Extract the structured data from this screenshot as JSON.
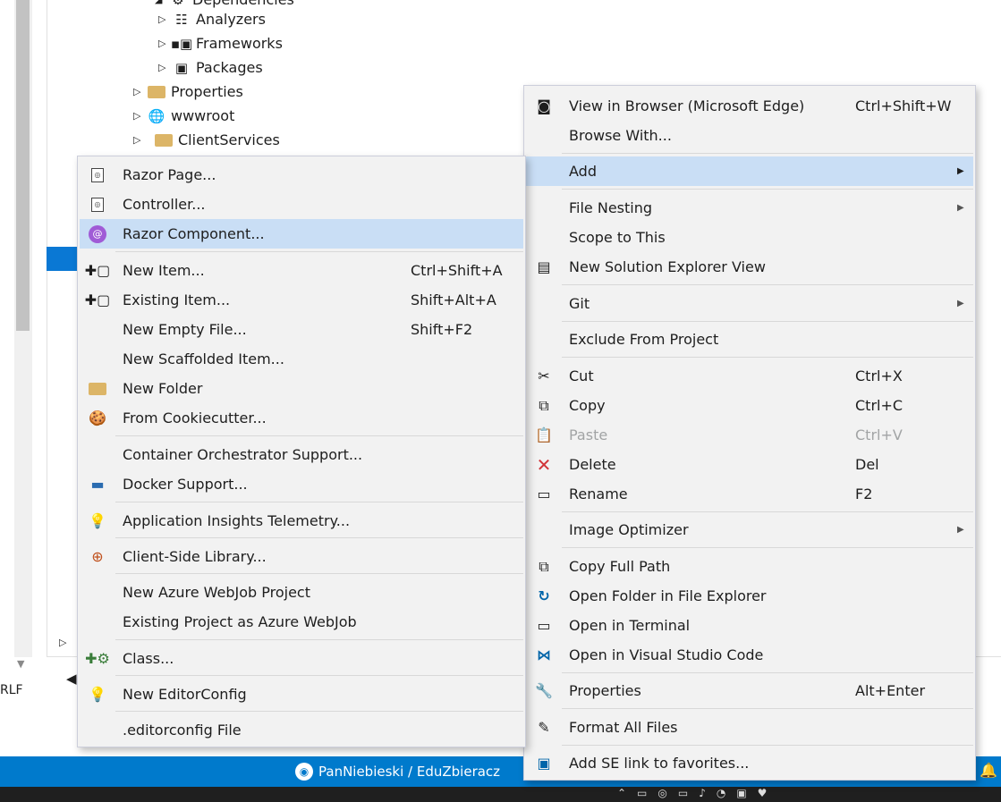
{
  "tree": {
    "nodes": [
      {
        "label": "Dependencies",
        "icon": "dependencies-icon"
      },
      {
        "label": "Analyzers",
        "icon": "analyzers-icon"
      },
      {
        "label": "Frameworks",
        "icon": "frameworks-icon"
      },
      {
        "label": "Packages",
        "icon": "packages-icon"
      },
      {
        "label": "Properties",
        "icon": "properties-folder-icon"
      },
      {
        "label": "wwwroot",
        "icon": "globe-icon"
      },
      {
        "label": "ClientServices",
        "icon": "folder-icon"
      }
    ]
  },
  "status": {
    "repo": "PanNiebieski / EduZbieracz",
    "line_ending": "RLF"
  },
  "add_submenu": {
    "items": [
      {
        "label": "Razor Page...",
        "shortcut": "",
        "icon": "razor-page-icon"
      },
      {
        "label": "Controller...",
        "shortcut": "",
        "icon": "controller-icon"
      },
      {
        "label": "Razor Component...",
        "shortcut": "",
        "icon": "blazor-icon"
      },
      {
        "label": "New Item...",
        "shortcut": "Ctrl+Shift+A",
        "icon": "new-item-icon"
      },
      {
        "label": "Existing Item...",
        "shortcut": "Shift+Alt+A",
        "icon": "existing-item-icon"
      },
      {
        "label": "New Empty File...",
        "shortcut": "Shift+F2",
        "icon": ""
      },
      {
        "label": "New Scaffolded Item...",
        "shortcut": "",
        "icon": ""
      },
      {
        "label": "New Folder",
        "shortcut": "",
        "icon": "new-folder-icon"
      },
      {
        "label": "From Cookiecutter...",
        "shortcut": "",
        "icon": "cookiecutter-icon"
      },
      {
        "label": "Container Orchestrator Support...",
        "shortcut": "",
        "icon": ""
      },
      {
        "label": "Docker Support...",
        "shortcut": "",
        "icon": "docker-icon"
      },
      {
        "label": "Application Insights Telemetry...",
        "shortcut": "",
        "icon": "app-insights-icon"
      },
      {
        "label": "Client-Side Library...",
        "shortcut": "",
        "icon": "client-library-icon"
      },
      {
        "label": "New Azure WebJob Project",
        "shortcut": "",
        "icon": ""
      },
      {
        "label": "Existing Project as Azure WebJob",
        "shortcut": "",
        "icon": ""
      },
      {
        "label": "Class...",
        "shortcut": "",
        "icon": "class-icon"
      },
      {
        "label": "New EditorConfig",
        "shortcut": "",
        "icon": "editorconfig-icon"
      },
      {
        "label": ".editorconfig File",
        "shortcut": "",
        "icon": ""
      }
    ]
  },
  "context_menu": {
    "items": [
      {
        "label": "View in Browser (Microsoft Edge)",
        "shortcut": "Ctrl+Shift+W",
        "icon": "browser-icon"
      },
      {
        "label": "Browse With...",
        "shortcut": "",
        "icon": ""
      },
      {
        "label": "Add",
        "shortcut": "",
        "icon": ""
      },
      {
        "label": "File Nesting",
        "shortcut": "",
        "icon": ""
      },
      {
        "label": "Scope to This",
        "shortcut": "",
        "icon": ""
      },
      {
        "label": "New Solution Explorer View",
        "shortcut": "",
        "icon": "solution-explorer-view-icon"
      },
      {
        "label": "Git",
        "shortcut": "",
        "icon": ""
      },
      {
        "label": "Exclude From Project",
        "shortcut": "",
        "icon": ""
      },
      {
        "label": "Cut",
        "shortcut": "Ctrl+X",
        "icon": "scissors-icon"
      },
      {
        "label": "Copy",
        "shortcut": "Ctrl+C",
        "icon": "copy-icon"
      },
      {
        "label": "Paste",
        "shortcut": "Ctrl+V",
        "icon": "paste-icon"
      },
      {
        "label": "Delete",
        "shortcut": "Del",
        "icon": "delete-icon"
      },
      {
        "label": "Rename",
        "shortcut": "F2",
        "icon": "rename-icon"
      },
      {
        "label": "Image Optimizer",
        "shortcut": "",
        "icon": ""
      },
      {
        "label": "Copy Full Path",
        "shortcut": "",
        "icon": "copy-path-icon"
      },
      {
        "label": "Open Folder in File Explorer",
        "shortcut": "",
        "icon": "open-folder-icon"
      },
      {
        "label": "Open in Terminal",
        "shortcut": "",
        "icon": "terminal-icon"
      },
      {
        "label": "Open in Visual Studio Code",
        "shortcut": "",
        "icon": "vscode-icon"
      },
      {
        "label": "Properties",
        "shortcut": "Alt+Enter",
        "icon": "wrench-icon"
      },
      {
        "label": "Format All Files",
        "shortcut": "",
        "icon": "format-files-icon"
      },
      {
        "label": "Add SE link to favorites...",
        "shortcut": "",
        "icon": "favorites-link-icon"
      }
    ]
  }
}
